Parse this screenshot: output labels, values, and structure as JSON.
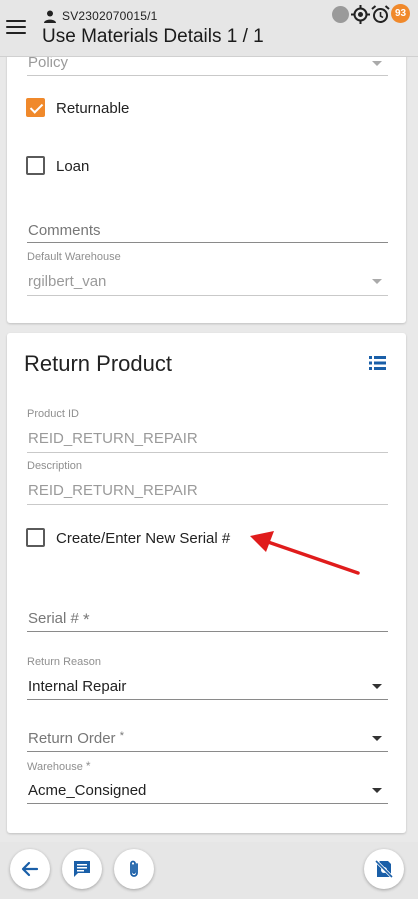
{
  "header": {
    "order_id": "SV2302070015/1",
    "title": "Use Materials Details 1 / 1",
    "notification_count": "93",
    "badge_color": "#f0892b"
  },
  "top_card": {
    "policy_placeholder": "Policy",
    "returnable": {
      "label": "Returnable",
      "checked": true
    },
    "loan": {
      "label": "Loan",
      "checked": false
    },
    "comments_placeholder": "Comments",
    "default_warehouse": {
      "label": "Default Warehouse",
      "value": "rgilbert_van"
    }
  },
  "return_card": {
    "title": "Return Product",
    "product_id": {
      "label": "Product ID",
      "value": "REID_RETURN_REPAIR"
    },
    "description": {
      "label": "Description",
      "value": "REID_RETURN_REPAIR"
    },
    "new_serial": {
      "label": "Create/Enter New Serial #",
      "checked": false
    },
    "serial": {
      "placeholder": "Serial #",
      "required_mark": "*"
    },
    "return_reason": {
      "label": "Return Reason",
      "value": "Internal Repair"
    },
    "return_order": {
      "placeholder": "Return Order",
      "required_mark": "*"
    },
    "warehouse": {
      "label": "Warehouse",
      "required_mark": "*",
      "value": "Acme_Consigned"
    }
  },
  "icons": {
    "menu": "hamburger-menu-icon",
    "back": "back-arrow-icon",
    "chat": "chat-icon",
    "attach": "paperclip-icon",
    "no_camera": "no-camera-icon",
    "list": "list-view-icon",
    "accent": "#1a5fa8"
  }
}
